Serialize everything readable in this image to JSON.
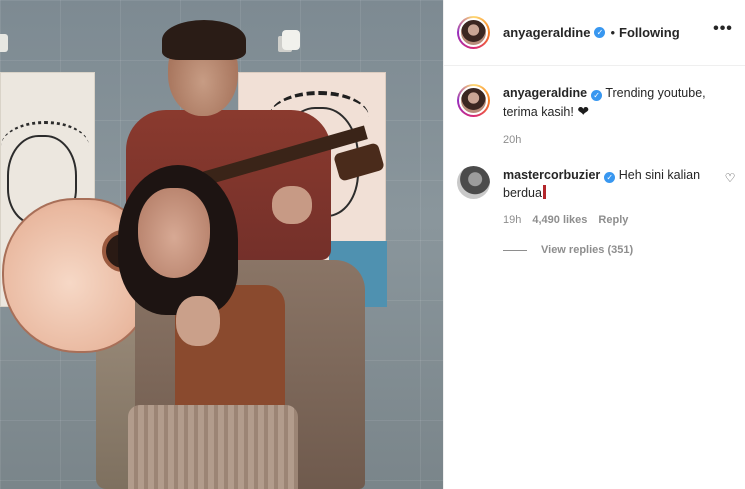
{
  "post": {
    "author": {
      "username": "anyageraldine",
      "verified": true,
      "follow_status": "Following",
      "separator": "•"
    },
    "caption": {
      "username": "anyageraldine",
      "text": "Trending youtube, terima kasih!",
      "emoji": "black-heart",
      "time": "20h"
    },
    "comments": [
      {
        "username": "mastercorbuzier",
        "verified": true,
        "text": "Heh sini kalian berdua",
        "time": "19h",
        "likes": "4,490 likes",
        "reply_label": "Reply",
        "view_replies": "View replies (351)"
      }
    ]
  },
  "icons": {
    "more": "more-options-icon",
    "verified": "verified-badge-icon",
    "like": "heart-outline-icon"
  },
  "colors": {
    "verified_badge": "#3897f0",
    "text_primary": "#262626",
    "text_secondary": "#8e8e8e",
    "cursor_mark": "#b3262b"
  }
}
